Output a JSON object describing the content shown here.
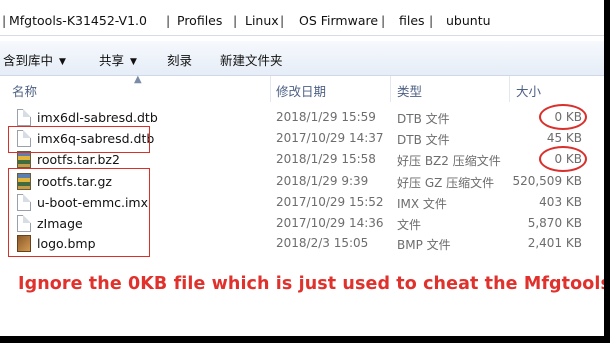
{
  "address": {
    "breadcrumbs": [
      "Mfgtools-K31452-V1.0",
      "Profiles",
      "Linux",
      "OS Firmware",
      "files",
      "ubuntu"
    ],
    "separator": "|"
  },
  "toolbar": {
    "include_in_library": "含到库中",
    "share": "共享",
    "burn": "刻录",
    "new_folder": "新建文件夹"
  },
  "columns": {
    "name": "名称",
    "modified": "修改日期",
    "type": "类型",
    "size": "大小"
  },
  "files": [
    {
      "name": "imx6dl-sabresd.dtb",
      "date": "2018/1/29 15:59",
      "type": "DTB 文件",
      "size": "0 KB",
      "icon": "document-icon"
    },
    {
      "name": "imx6q-sabresd.dtb",
      "date": "2017/10/29 14:37",
      "type": "DTB 文件",
      "size": "45 KB",
      "icon": "document-icon"
    },
    {
      "name": "rootfs.tar.bz2",
      "date": "2018/1/29 15:58",
      "type": "好压 BZ2 压缩文件",
      "size": "0 KB",
      "icon": "archive-icon"
    },
    {
      "name": "rootfs.tar.gz",
      "date": "2018/1/29 9:39",
      "type": "好压 GZ 压缩文件",
      "size": "520,509 KB",
      "icon": "archive-icon"
    },
    {
      "name": "u-boot-emmc.imx",
      "date": "2017/10/29 15:52",
      "type": "IMX 文件",
      "size": "403 KB",
      "icon": "document-icon"
    },
    {
      "name": "zImage",
      "date": "2017/10/29 14:36",
      "type": "文件",
      "size": "5,870 KB",
      "icon": "document-icon"
    },
    {
      "name": "logo.bmp",
      "date": "2018/2/3 15:05",
      "type": "BMP 文件",
      "size": "2,401 KB",
      "icon": "image-icon"
    }
  ],
  "annotation": {
    "note": "Ignore the 0KB file which is just used to cheat the Mfgtools",
    "color": "#e0312c"
  }
}
